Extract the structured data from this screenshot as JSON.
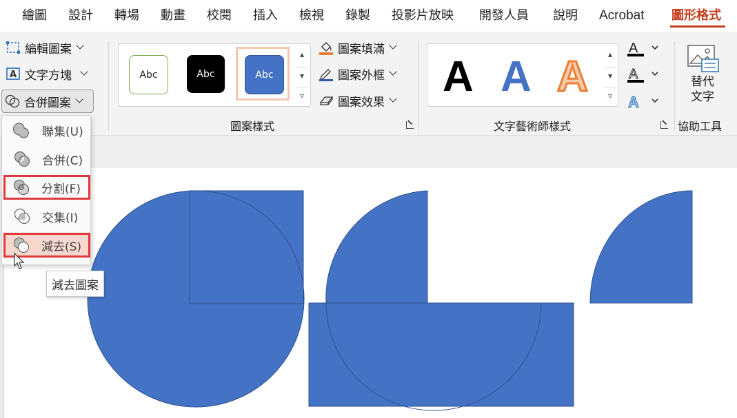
{
  "tabs": [
    {
      "label": "繪圖"
    },
    {
      "label": "設計"
    },
    {
      "label": "轉場"
    },
    {
      "label": "動畫"
    },
    {
      "label": "校閱"
    },
    {
      "label": "插入"
    },
    {
      "label": "檢視"
    },
    {
      "label": "錄製"
    },
    {
      "label": "投影片放映"
    },
    {
      "label": "開發人員"
    },
    {
      "label": "說明"
    },
    {
      "label": "Acrobat"
    },
    {
      "label": "圖形格式"
    }
  ],
  "active_tab": "圖形格式",
  "insert_group": {
    "edit_shape": "編輯圖案",
    "text_box": "文字方塊",
    "merge_shapes": "合併圖案"
  },
  "shape_styles": {
    "group_label": "圖案樣式",
    "samples": [
      "Abc",
      "Abc",
      "Abc"
    ],
    "fill": "圖案填滿",
    "outline": "圖案外框",
    "effects": "圖案效果"
  },
  "wordart": {
    "group_label": "文字藝術師樣式",
    "samples": [
      "A",
      "A",
      "A"
    ]
  },
  "accessibility": {
    "group_label": "協助工具",
    "alt_text_line1": "替代",
    "alt_text_line2": "文字"
  },
  "merge_menu": {
    "items": [
      {
        "label": "聯集(U)",
        "key": "U"
      },
      {
        "label": "合併(C)",
        "key": "C"
      },
      {
        "label": "分割(F)",
        "key": "F"
      },
      {
        "label": "交集(I)",
        "key": "I"
      },
      {
        "label": "減去(S)",
        "key": "S"
      }
    ]
  },
  "tooltip": "減去圖案",
  "colors": {
    "accent": "#c43e1c",
    "shape_fill": "#4472c4",
    "shape_outline": "#2f528f",
    "highlight_border": "#e0393e",
    "hover_bg": "#f7d8cf",
    "abc_green": "#70ad47",
    "wordart_blue": "#4472c4",
    "wordart_orange": "#ed7d31"
  }
}
